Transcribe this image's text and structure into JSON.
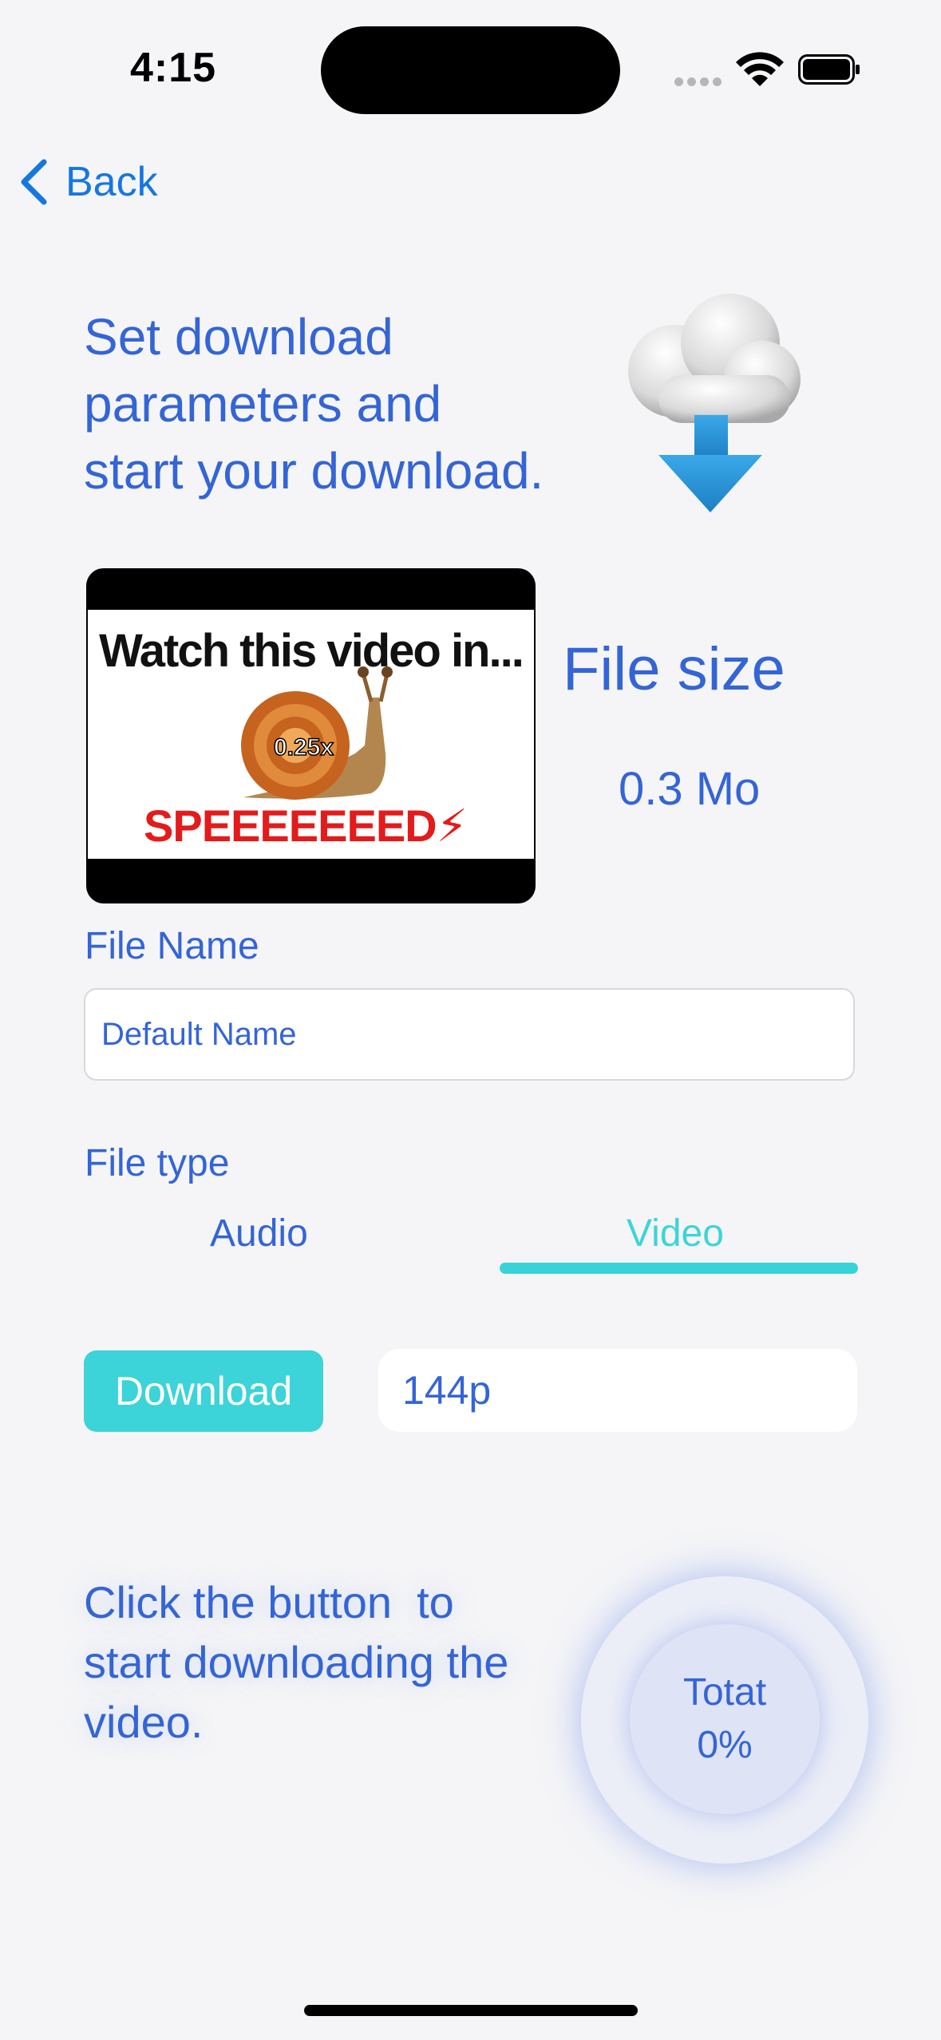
{
  "status_bar": {
    "time": "4:15"
  },
  "nav": {
    "back_label": "Back"
  },
  "hero": {
    "text_line1": "Set download",
    "text_line2": "parameters and",
    "text_line3": "start your download."
  },
  "thumbnail": {
    "title": "Watch this video in...",
    "badge": "0.25x",
    "caption": "SPEEEEEEED⚡"
  },
  "file_size": {
    "label": "File size",
    "value": "0.3 Mo"
  },
  "file_name": {
    "label": "File Name",
    "placeholder": "Default Name"
  },
  "file_type": {
    "label": "File type",
    "tabs": [
      {
        "label": "Audio",
        "selected": false
      },
      {
        "label": "Video",
        "selected": true
      }
    ]
  },
  "download": {
    "button_label": "Download",
    "quality": "144p"
  },
  "progress": {
    "hint_line1": "Click the button  to",
    "hint_line2": "start downloading the",
    "hint_line3": "video.",
    "label": "Totat",
    "percent": "0%"
  },
  "colors": {
    "text_blue": "#3465d6",
    "accent_teal": "#3cd3d9",
    "link_blue": "#1677e0",
    "background": "#f5f5f7"
  }
}
